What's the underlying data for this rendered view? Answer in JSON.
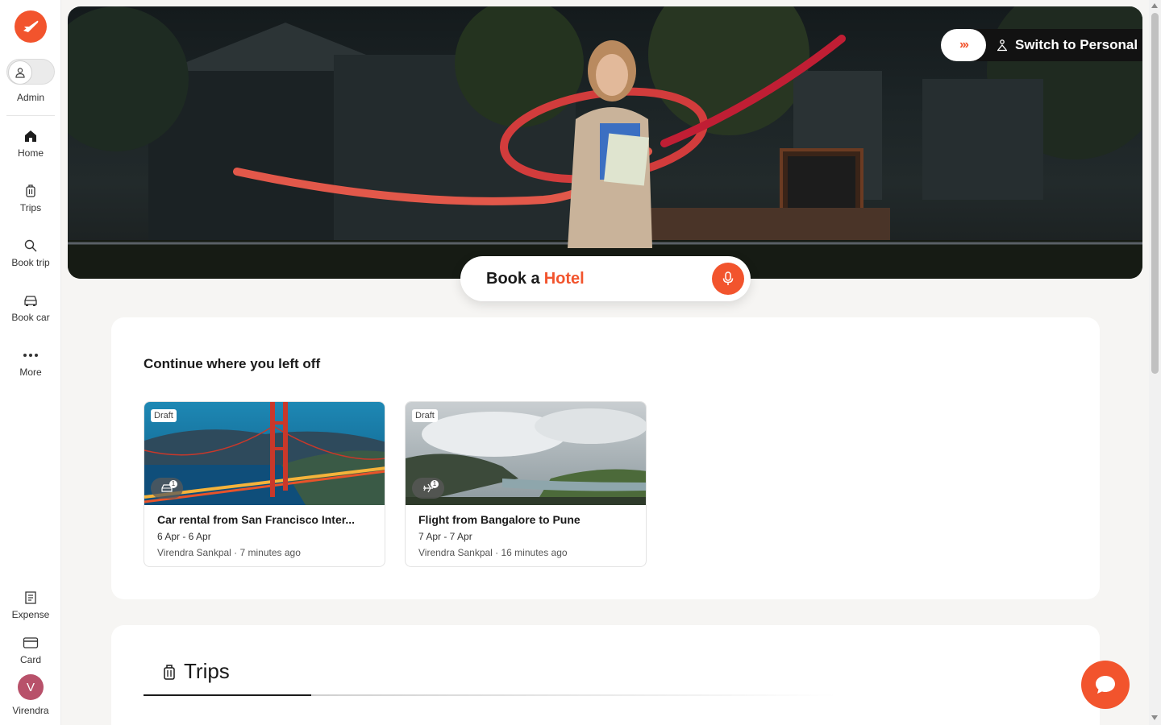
{
  "sidebar": {
    "logo_icon": "plane-logo-icon",
    "admin_label": "Admin",
    "nav": [
      {
        "label": "Home",
        "icon": "home-icon"
      },
      {
        "label": "Trips",
        "icon": "luggage-icon"
      },
      {
        "label": "Book trip",
        "icon": "search-icon"
      },
      {
        "label": "Book car",
        "icon": "car-icon"
      },
      {
        "label": "More",
        "icon": "more-dots-icon"
      }
    ],
    "bottom": [
      {
        "label": "Expense",
        "icon": "receipt-icon"
      },
      {
        "label": "Card",
        "icon": "card-icon"
      }
    ],
    "user": {
      "initial": "V",
      "name": "Virendra"
    }
  },
  "hero": {
    "switch_label": "Switch to Personal",
    "book_prefix": "Book a",
    "book_highlight": "Hotel"
  },
  "continue": {
    "title": "Continue where you left off",
    "cards": [
      {
        "badge": "Draft",
        "type_icon": "car-icon",
        "count": "1",
        "title": "Car rental from San Francisco Inter...",
        "dates": "6 Apr - 6 Apr",
        "meta": "Virendra Sankpal · 7 minutes ago"
      },
      {
        "badge": "Draft",
        "type_icon": "plane-icon",
        "count": "1",
        "title": "Flight from Bangalore to Pune",
        "dates": "7 Apr - 7 Apr",
        "meta": "Virendra Sankpal · 16 minutes ago"
      }
    ]
  },
  "trips_section": {
    "tab_label": "Trips"
  },
  "colors": {
    "accent": "#f2542d",
    "avatar": "#b8516a"
  }
}
